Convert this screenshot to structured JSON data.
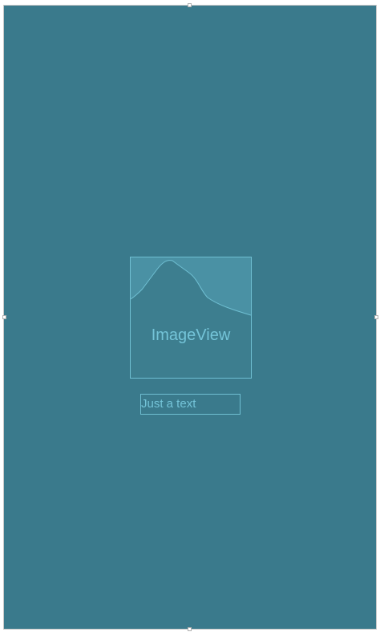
{
  "canvas": {
    "background_color": "#3a7a8c",
    "outline_color": "#6fbfd2",
    "text_color": "#74c4d8"
  },
  "image_view": {
    "placeholder_label": "ImageView",
    "icon": "mountain-placeholder-icon"
  },
  "text_view": {
    "text": "Just a text"
  }
}
